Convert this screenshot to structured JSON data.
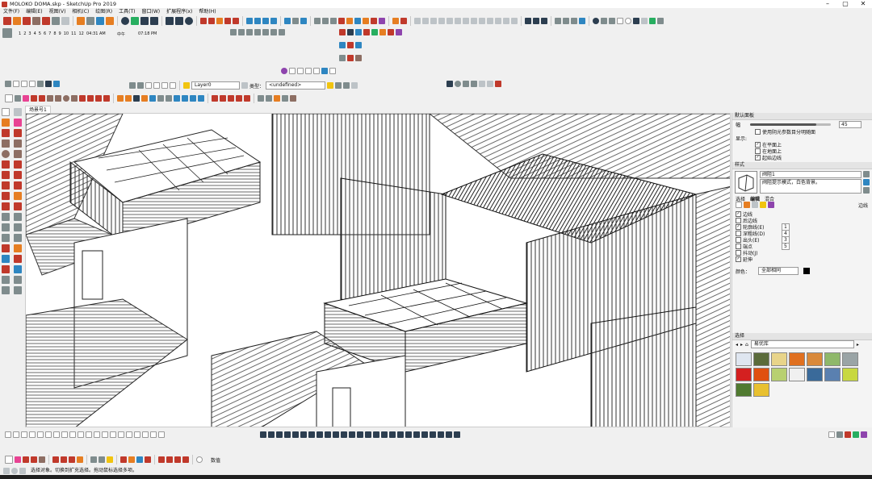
{
  "window": {
    "title": "MOLOKO DOMA.skp - SketchUp Pro 2019",
    "controls": [
      "–",
      "▢",
      "✕"
    ]
  },
  "menu": [
    "文件(F)",
    "编辑(E)",
    "视图(V)",
    "相机(C)",
    "绘图(R)",
    "工具(T)",
    "窗口(W)",
    "扩展程序(x)",
    "帮助(H)"
  ],
  "timeline": {
    "months": [
      "1",
      "2",
      "3",
      "4",
      "5",
      "6",
      "7",
      "8",
      "9",
      "10",
      "11",
      "12"
    ],
    "time_start": "04:31 AM",
    "midday": "中午",
    "time_end": "07:18 PM"
  },
  "styles_toolbar": {
    "layer_value": "Layer0",
    "type_label": "类型：",
    "type_value": "<undefined>"
  },
  "scene_tab": "场景号1",
  "right_panel": {
    "tray_title": "默认面板",
    "fog": {
      "label": "幅",
      "value": "45",
      "slider_fraction": 0.82
    },
    "use_bg_color_label": "使用阴光参数目分明随面",
    "display_label": "显示:",
    "display_options": [
      {
        "label": "在平面上",
        "checked": true
      },
      {
        "label": "在地面上",
        "checked": false
      },
      {
        "label": "起始边线",
        "checked": true
      }
    ],
    "styles_section": "样式",
    "style_name": "阀阻1",
    "style_desc": "阀阻提示模式，白色背景。",
    "style_tabs": [
      "选择",
      "编辑",
      "混合"
    ],
    "sync_label": "边线",
    "edge_settings": [
      {
        "label": "边线",
        "checked": true,
        "value": ""
      },
      {
        "label": "后边线",
        "checked": false,
        "value": ""
      },
      {
        "label": "轮廓线(E)",
        "checked": true,
        "value": "1"
      },
      {
        "label": "深粗线(D)",
        "checked": false,
        "value": "4"
      },
      {
        "label": "出头(E)",
        "checked": false,
        "value": "3"
      },
      {
        "label": "端点",
        "checked": false,
        "value": "5"
      },
      {
        "label": "抖动(J)",
        "checked": false,
        "value": ""
      },
      {
        "label": "延伸",
        "checked": true,
        "value": ""
      }
    ],
    "color_label": "颜色：",
    "color_value": "全部相同",
    "select_section": "选择",
    "materials_dropdown": "易优库",
    "swatches": [
      "#dfe6f0",
      "#5b6b3a",
      "#e8d48a",
      "#e07020",
      "#d9893a",
      "#8fb86a",
      "#9aa4a6",
      "#d42020",
      "#e05010",
      "#b8d070",
      "#f0f0f0",
      "#3a6a9a",
      "#5a80b0",
      "#c8d840",
      "#507a30",
      "#e8c030"
    ]
  },
  "status": {
    "text": "选择对象。切换到扩充选择。拖动鼠标选择多项。",
    "measurement_label": "数值"
  }
}
